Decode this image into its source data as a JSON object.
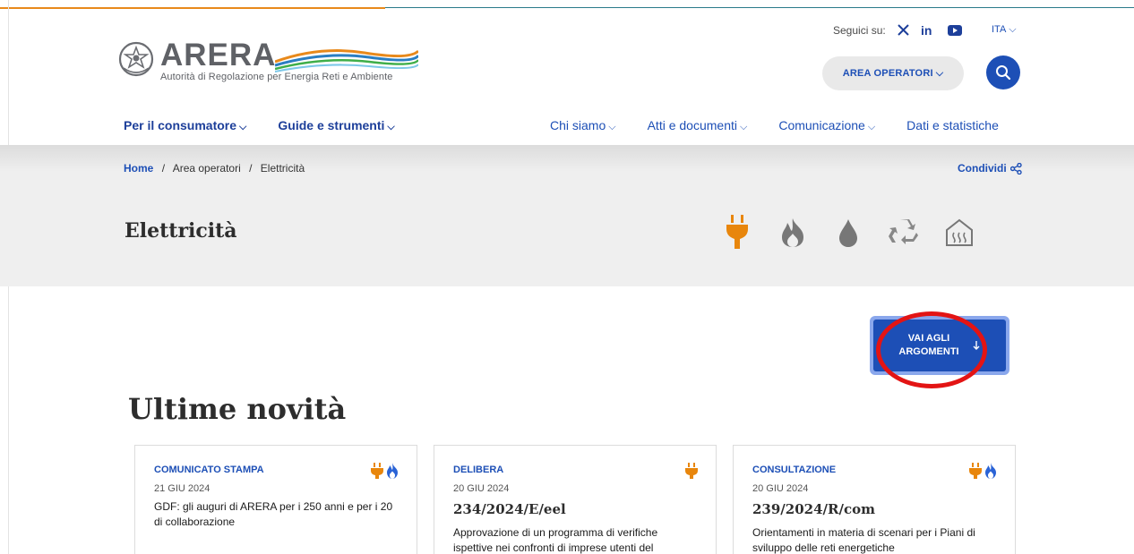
{
  "brand": {
    "logo_word": "ARERA",
    "logo_subtitle": "Autorità di Regolazione per Energia Reti e Ambiente"
  },
  "header": {
    "follow_label": "Seguici su:",
    "language": "ITA",
    "area_operators_button": "AREA OPERATORI"
  },
  "nav": {
    "left": [
      {
        "label": "Per il consumatore"
      },
      {
        "label": "Guide e strumenti"
      }
    ],
    "right": [
      {
        "label": "Chi siamo"
      },
      {
        "label": "Atti e documenti"
      },
      {
        "label": "Comunicazione"
      },
      {
        "label": "Dati e statistiche"
      }
    ]
  },
  "breadcrumb": [
    "Home",
    "Area operatori",
    "Elettricità"
  ],
  "share_label": "Condividi",
  "page_title": "Elettricità",
  "goto_button": {
    "line1": "VAI AGLI",
    "line2": "ARGOMENTI"
  },
  "section_title": "Ultime novità",
  "cards": [
    {
      "category": "COMUNICATO STAMPA",
      "date": "21 GIU 2024",
      "title": "",
      "text": "GDF: gli auguri di ARERA per i 250 anni e per i 20 di collaborazione"
    },
    {
      "category": "DELIBERA",
      "date": "20 GIU 2024",
      "title": "234/2024/E/eel",
      "text": "Approvazione di un programma di verifiche ispettive nei confronti di imprese utenti del"
    },
    {
      "category": "CONSULTAZIONE",
      "date": "20 GIU 2024",
      "title": "239/2024/R/com",
      "text": "Orientamenti in materia di scenari per i Piani di sviluppo delle reti energetiche"
    }
  ],
  "colors": {
    "primary_blue": "#1d4fb6",
    "electric_orange": "#e8860c",
    "gas_blue": "#2a63d6",
    "highlight_red": "#e31414",
    "hero_bg": "#efefef"
  },
  "icons": {
    "sectors": [
      "plug-icon",
      "flame-icon",
      "drop-icon",
      "recycle-icon",
      "heating-icon"
    ],
    "social": [
      "x-icon",
      "linkedin-icon",
      "youtube-icon"
    ]
  }
}
